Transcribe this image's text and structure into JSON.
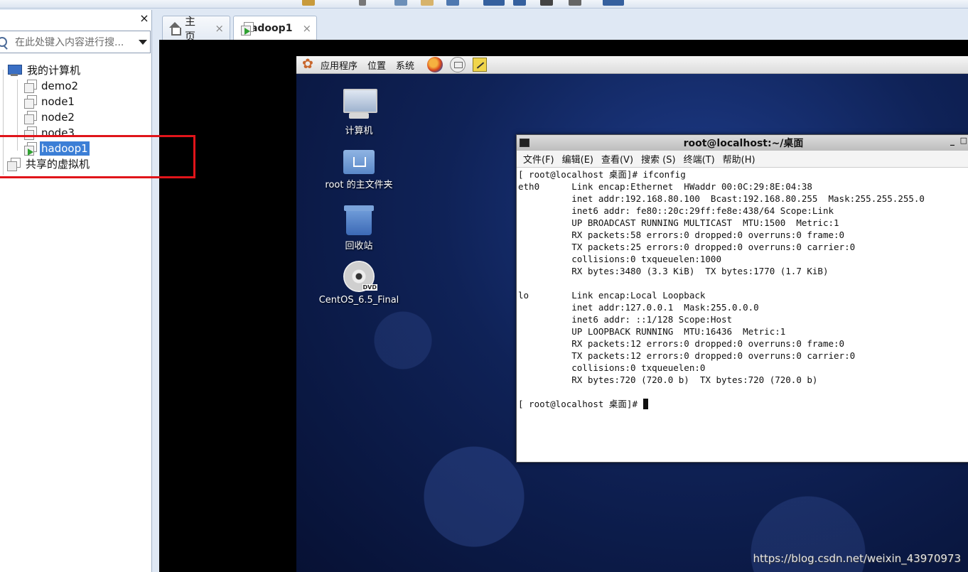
{
  "library": {
    "search_placeholder": "在此处键入内容进行搜...",
    "close_glyph": "×",
    "tree": {
      "root": "我的计算机",
      "vms": [
        {
          "name": "demo2",
          "selected": false
        },
        {
          "name": "node1",
          "selected": false
        },
        {
          "name": "node2",
          "selected": false
        },
        {
          "name": "node3",
          "selected": false
        },
        {
          "name": "hadoop1",
          "selected": true
        }
      ],
      "shared": "共享的虚拟机"
    }
  },
  "tabs": [
    {
      "label": "主页",
      "icon": "home-icon",
      "close": "×",
      "active": false
    },
    {
      "label": "hadoop1",
      "icon": "vm-icon",
      "close": "×",
      "active": true
    }
  ],
  "guest": {
    "panel_menus": [
      "应用程序",
      "位置",
      "系统"
    ],
    "desktop_icons": [
      {
        "label": "计算机",
        "icon": "computer-icon"
      },
      {
        "label": "root 的主文件夹",
        "icon": "home-folder-icon"
      },
      {
        "label": "回收站",
        "icon": "trash-icon"
      },
      {
        "label": "CentOS_6.5_Final",
        "icon": "dvd-icon"
      }
    ],
    "terminal": {
      "title": "root@localhost:~/桌面",
      "menus": [
        "文件(F)",
        "编辑(E)",
        "查看(V)",
        "搜索 (S)",
        "终端(T)",
        "帮助(H)"
      ],
      "lines": [
        "[ root@localhost 桌面]# ifconfig",
        "eth0      Link encap:Ethernet  HWaddr 00:0C:29:8E:04:38",
        "          inet addr:192.168.80.100  Bcast:192.168.80.255  Mask:255.255.255.0",
        "          inet6 addr: fe80::20c:29ff:fe8e:438/64 Scope:Link",
        "          UP BROADCAST RUNNING MULTICAST  MTU:1500  Metric:1",
        "          RX packets:58 errors:0 dropped:0 overruns:0 frame:0",
        "          TX packets:25 errors:0 dropped:0 overruns:0 carrier:0",
        "          collisions:0 txqueuelen:1000",
        "          RX bytes:3480 (3.3 KiB)  TX bytes:1770 (1.7 KiB)",
        "",
        "lo        Link encap:Local Loopback",
        "          inet addr:127.0.0.1  Mask:255.0.0.0",
        "          inet6 addr: ::1/128 Scope:Host",
        "          UP LOOPBACK RUNNING  MTU:16436  Metric:1",
        "          RX packets:12 errors:0 dropped:0 overruns:0 frame:0",
        "          TX packets:12 errors:0 dropped:0 overruns:0 carrier:0",
        "          collisions:0 txqueuelen:0",
        "          RX bytes:720 (720.0 b)  TX bytes:720 (720.0 b)",
        ""
      ],
      "prompt": "[ root@localhost 桌面]# "
    }
  },
  "watermark": "https://blog.csdn.net/weixin_43970973",
  "colors": {
    "selection": "#3c7fd6",
    "highlight_box": "#e0141a",
    "desktop": "#0f2257"
  }
}
